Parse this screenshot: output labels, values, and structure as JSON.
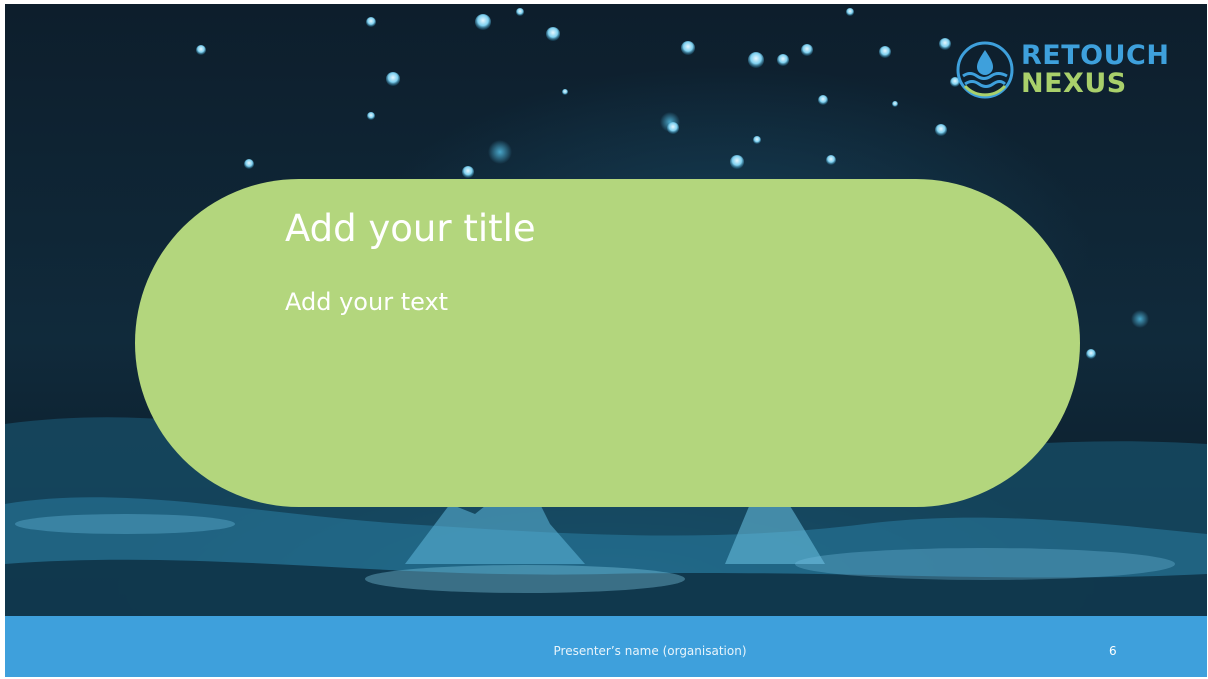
{
  "slide": {
    "title": "Add your title",
    "text": "Add your text",
    "page_number": "6"
  },
  "logo": {
    "line1": "RETOUCH",
    "line2": "NEXUS",
    "icon": "water-drop-waves-icon"
  },
  "footer": {
    "presenter": "Presenter’s name (organisation)"
  },
  "colors": {
    "pill": "#b3d67d",
    "footer": "#3ea0dc",
    "logo_blue": "#3ea0dc",
    "logo_green": "#a9d06b",
    "text": "#ffffff"
  }
}
